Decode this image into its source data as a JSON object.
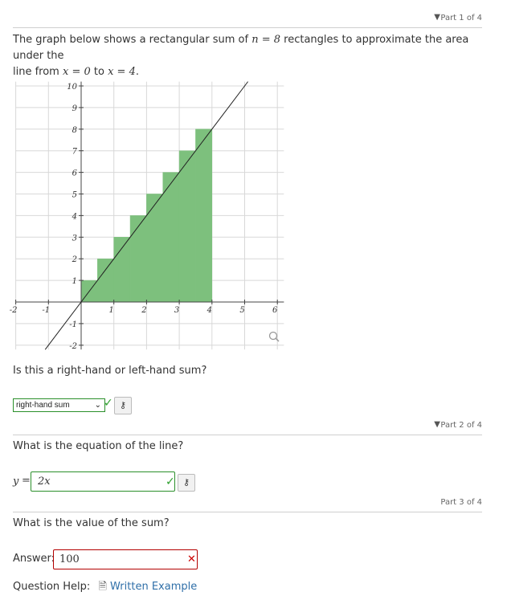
{
  "part1": {
    "header": "Part 1 of 4",
    "intro_pre": "The graph below shows a rectangular sum of ",
    "intro_n": "n = 8",
    "intro_mid": " rectangles to approximate the area under the",
    "intro_line2_pre": "line from ",
    "intro_x0": "x = 0",
    "intro_to": " to ",
    "intro_x4": "x = 4",
    "intro_end": ".",
    "question": "Is this a right-hand or left-hand sum?",
    "selected": "right-hand sum"
  },
  "part2": {
    "header": "Part 2 of 4",
    "question": "What is the equation of the line?",
    "y_label": "y",
    "equals": "=",
    "answer": "2x"
  },
  "part3": {
    "header": "Part 3 of 4",
    "question": "What is the value of the sum?",
    "answer_label": "Answer:",
    "answer": "100"
  },
  "help": {
    "label": "Question Help:",
    "link": "Written Example"
  },
  "icons": {
    "dropdown": "chevron-down-icon",
    "check": "check-icon",
    "key": "key-icon",
    "error": "x-icon",
    "zoom": "magnifier-icon",
    "doc": "document-icon"
  },
  "colors": {
    "rect_fill": "#7dc07d",
    "correct": "#2a8f2a",
    "incorrect": "#b30000",
    "link": "#2f6fa8"
  },
  "chart_data": {
    "type": "bar",
    "x_ticks": [
      "-2",
      "-1",
      "1",
      "2",
      "3",
      "4",
      "5",
      "6"
    ],
    "y_ticks": [
      "-2",
      "-1",
      "1",
      "2",
      "3",
      "4",
      "5",
      "6",
      "7",
      "8",
      "9",
      "10"
    ],
    "xlim": [
      -2,
      6.2
    ],
    "ylim": [
      -2.2,
      10.2
    ],
    "rectangles": [
      {
        "x0": 0,
        "x1": 0.5,
        "height": 1
      },
      {
        "x0": 0.5,
        "x1": 1,
        "height": 2
      },
      {
        "x0": 1,
        "x1": 1.5,
        "height": 3
      },
      {
        "x0": 1.5,
        "x1": 2,
        "height": 4
      },
      {
        "x0": 2,
        "x1": 2.5,
        "height": 5
      },
      {
        "x0": 2.5,
        "x1": 3,
        "height": 6
      },
      {
        "x0": 3,
        "x1": 3.5,
        "height": 7
      },
      {
        "x0": 3.5,
        "x1": 4,
        "height": 8
      }
    ],
    "line": {
      "slope": 2,
      "intercept": 0,
      "x_range": [
        -1.1,
        5.1
      ]
    },
    "grid": true
  }
}
